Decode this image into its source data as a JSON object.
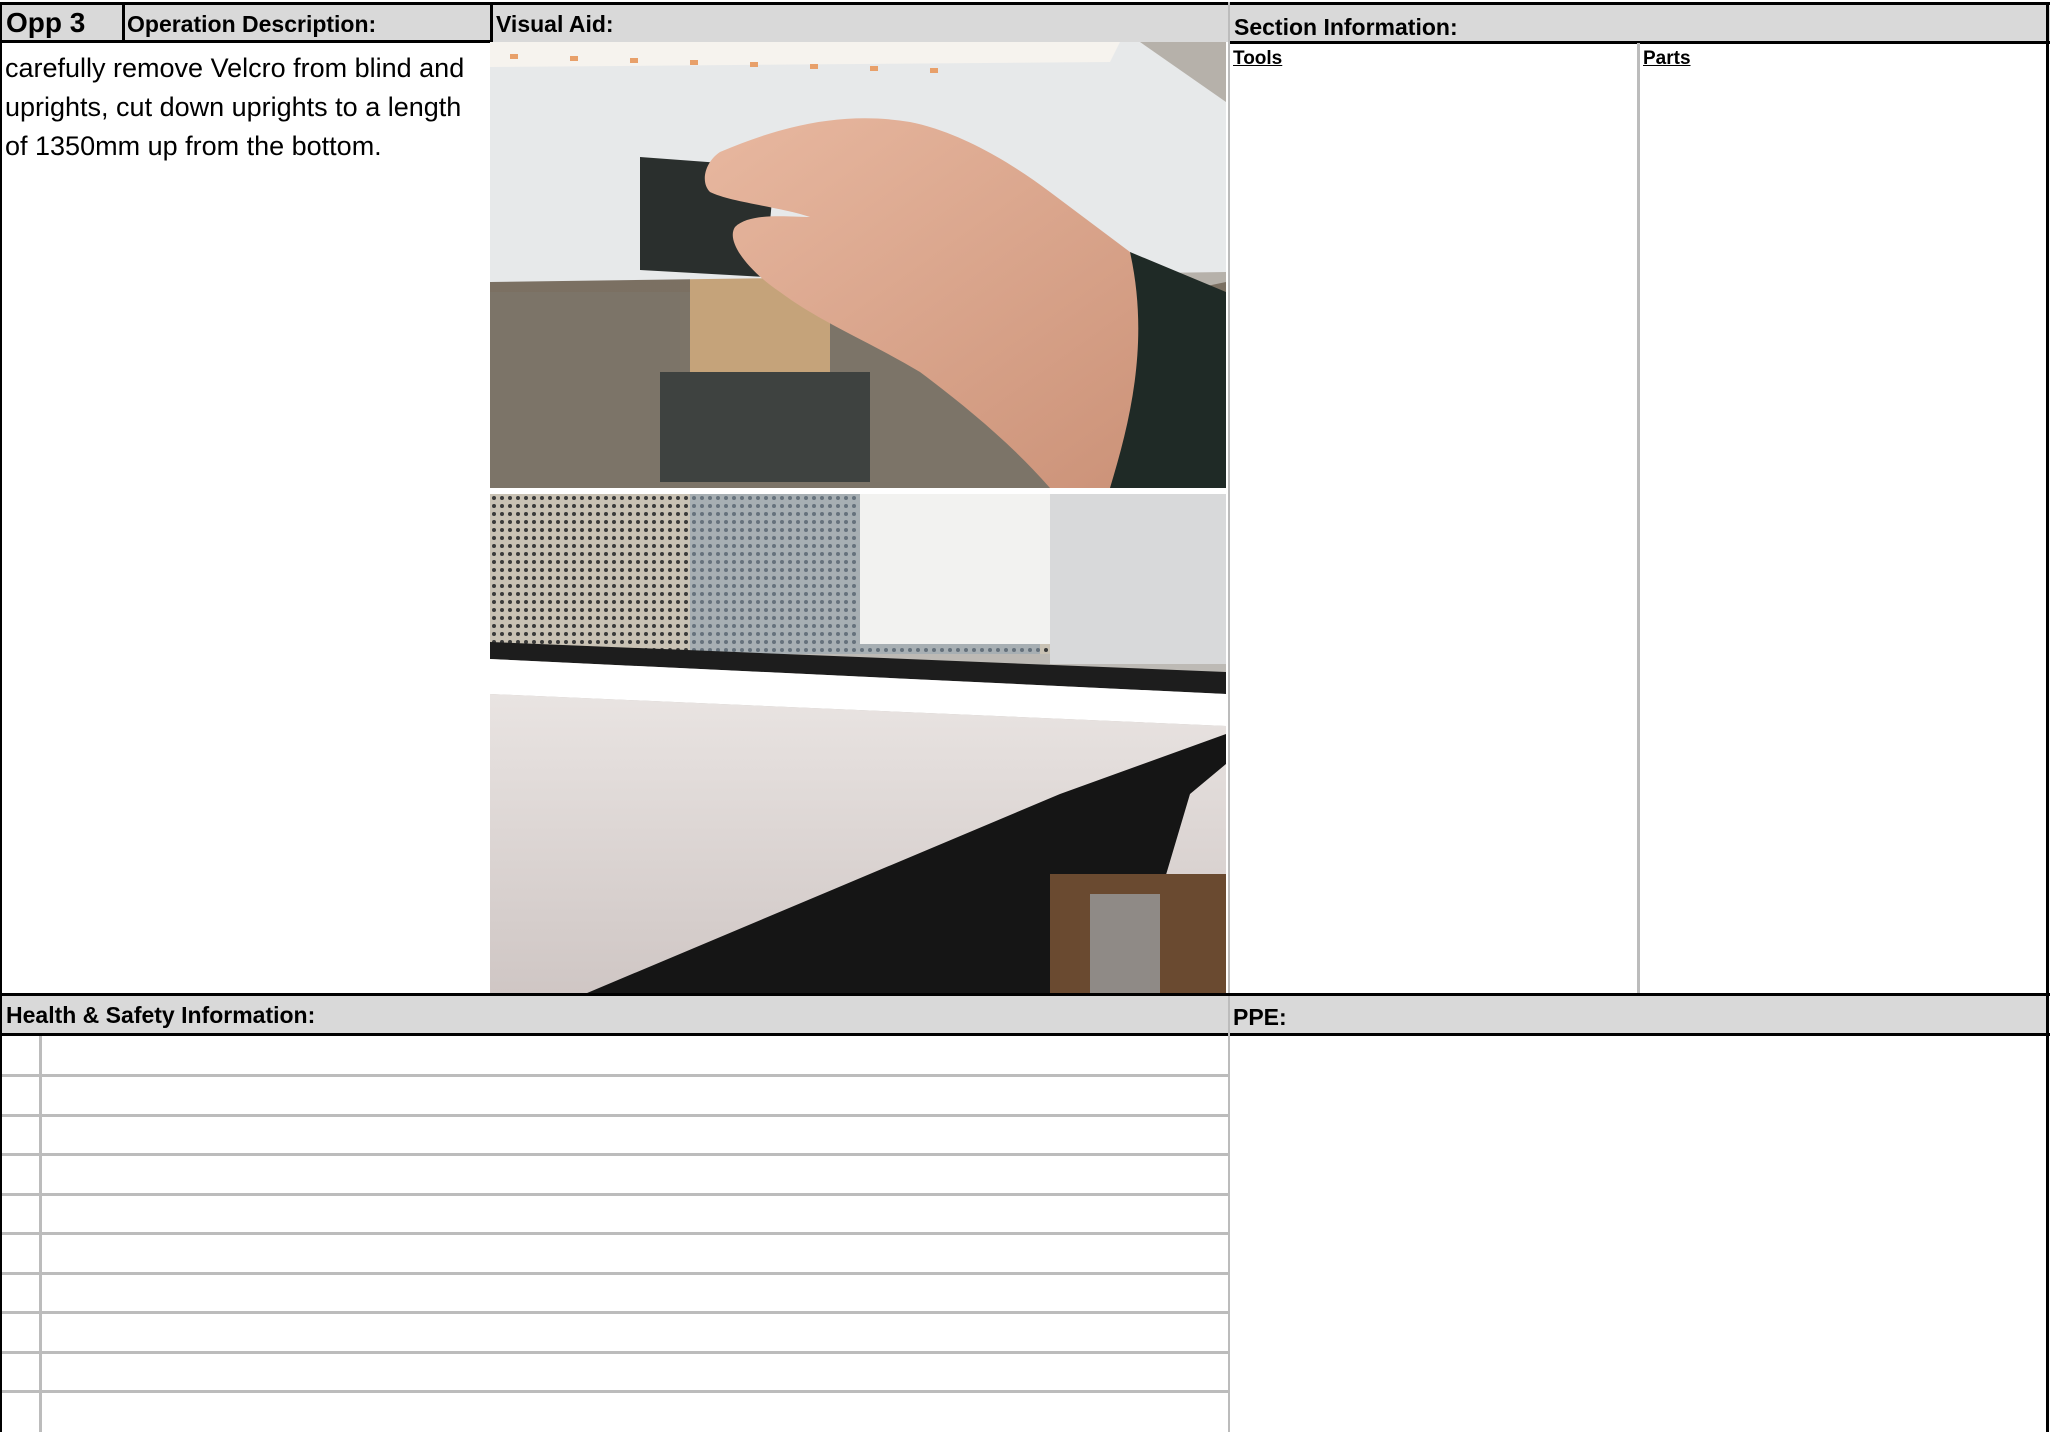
{
  "header": {
    "opp": "Opp 3",
    "operation_description": "Operation Description:",
    "visual_aid": "Visual Aid:",
    "section_information": "Section Information:"
  },
  "description": "carefully remove Velcro from blind and uprights, cut down uprights to a length of 1350mm up from the bottom.",
  "section": {
    "tools": "Tools ",
    "parts": "Parts"
  },
  "health_safety": {
    "title": "Health & Safety Information:",
    "rows": 10
  },
  "ppe": {
    "title": "PPE:"
  },
  "photos": [
    {
      "icon": "hand-removing-velcro-photo"
    },
    {
      "icon": "window-with-velcro-strip-photo"
    }
  ]
}
